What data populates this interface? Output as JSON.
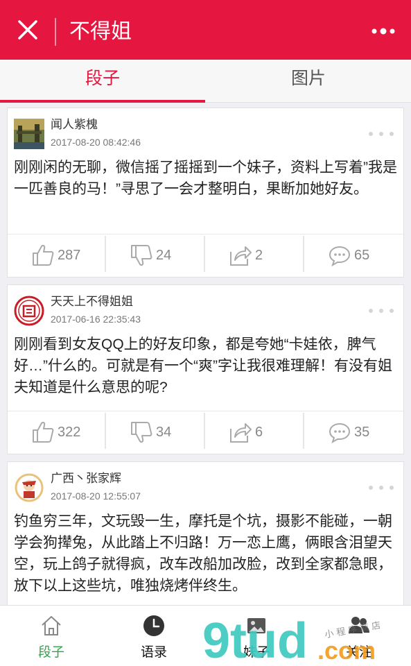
{
  "header": {
    "title": "不得姐",
    "close_icon": "close-icon",
    "more_icon": "more-dots-icon",
    "background": "#e5163f"
  },
  "tabs": [
    {
      "label": "段子",
      "active": true
    },
    {
      "label": "图片",
      "active": false
    }
  ],
  "posts": [
    {
      "author": "闻人紫槐",
      "time": "2017-08-20 08:42:46",
      "content": "刚刚闲的无聊，微信摇了摇摇到一个妹子，资料上写着”我是一匹善良的马！”寻思了一会才整明白，果断加她好友。",
      "likes": "287",
      "dislikes": "24",
      "shares": "2",
      "comments": "65"
    },
    {
      "author": "天天上不得姐姐",
      "time": "2017-06-16 22:35:43",
      "content": "刚刚看到女友QQ上的好友印象，都是夸她“卡娃依，脾气好…”什么的。可就是有一个“爽”字让我很难理解！有没有姐夫知道是什么意思的呢?",
      "likes": "322",
      "dislikes": "34",
      "shares": "6",
      "comments": "35"
    },
    {
      "author": "广西丶张家辉",
      "time": "2017-08-20 12:55:07",
      "content": "钓鱼穷三年，文玩毁一生，摩托是个坑，摄影不能碰，一朝学会狗撵兔，从此踏上不归路！万一恋上鹰，俩眼含泪望天空，玩上鸽子就得疯，改车改船加改脸，改到全家都急眼，放下以上这些坑，唯独烧烤伴终生。"
    }
  ],
  "bottom_nav": [
    {
      "label": "段子",
      "icon": "home-icon",
      "active": true
    },
    {
      "label": "语录",
      "icon": "clock-icon",
      "active": false
    },
    {
      "label": "妹子",
      "icon": "photo-icon",
      "active": false
    },
    {
      "label": "关注",
      "icon": "users-icon",
      "active": false
    }
  ],
  "watermark": {
    "logo_text": "9tud",
    "suffix": ".com",
    "tag": "小 程 序 商 店"
  },
  "colors": {
    "accent": "#e5163f",
    "nav_active": "#2aa846",
    "watermark_teal": "#3fc9c0",
    "watermark_orange": "#f29a1b"
  }
}
